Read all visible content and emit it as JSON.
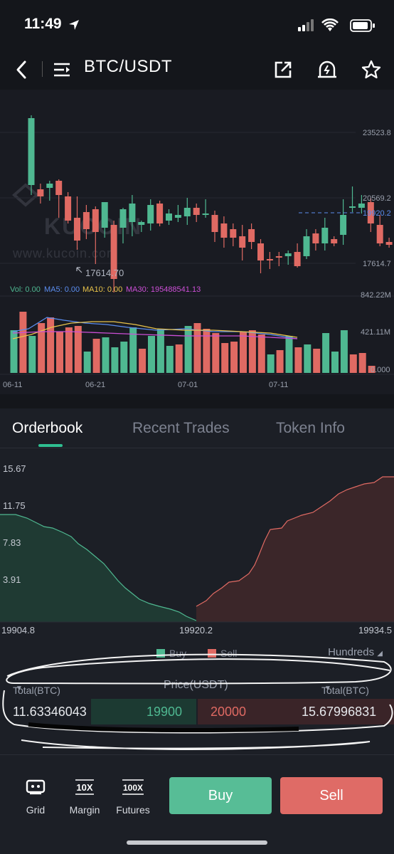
{
  "status": {
    "time": "11:49"
  },
  "nav": {
    "title": "BTC/USDT"
  },
  "watermark": {
    "brand": "KUCOIN",
    "url": "www.kucoin.com"
  },
  "kline": {
    "price_labels": [
      "23523.8",
      "20569.2",
      "17614.7"
    ],
    "current_price_label": "19920.2",
    "low_marker_label": "17614.70",
    "indicators": {
      "vol": "Vol: 0.00",
      "ma5": "MA5: 0.00",
      "ma10": "MA10: 0.00",
      "ma30": "MA30: 195488541.13"
    },
    "volume_labels": [
      "842.22M",
      "421.11M",
      "0.000"
    ],
    "date_labels": [
      "06-11",
      "06-21",
      "07-01",
      "07-11"
    ],
    "colors": {
      "up": "#4fb891",
      "down": "#e06a63",
      "ma5": "#5b8def",
      "ma10": "#e8c34a",
      "ma30": "#cc4fd6"
    }
  },
  "tabs": [
    {
      "label": "Orderbook",
      "active": true
    },
    {
      "label": "Recent Trades",
      "active": false
    },
    {
      "label": "Token Info",
      "active": false
    }
  ],
  "depth": {
    "y_labels": [
      "15.67",
      "11.75",
      "7.83",
      "3.91"
    ],
    "x_labels": [
      "19904.8",
      "19920.2",
      "19934.5"
    ]
  },
  "legend": {
    "buy": "Buy",
    "sell": "Sell",
    "hundreds": "Hundreds"
  },
  "orderbook": {
    "header_left": "Total(BTC)",
    "header_mid": "Price(USDT)",
    "header_right": "Total(BTC)",
    "bid_total": "11.63346043",
    "bid_price": "19900",
    "ask_price": "20000",
    "ask_total": "15.67996831"
  },
  "bottom": {
    "grid_icon": "10X",
    "grid": "Grid",
    "margin_icon": "10X",
    "margin": "Margin",
    "futures_icon": "100X",
    "futures": "Futures",
    "buy": "Buy",
    "sell": "Sell"
  }
}
